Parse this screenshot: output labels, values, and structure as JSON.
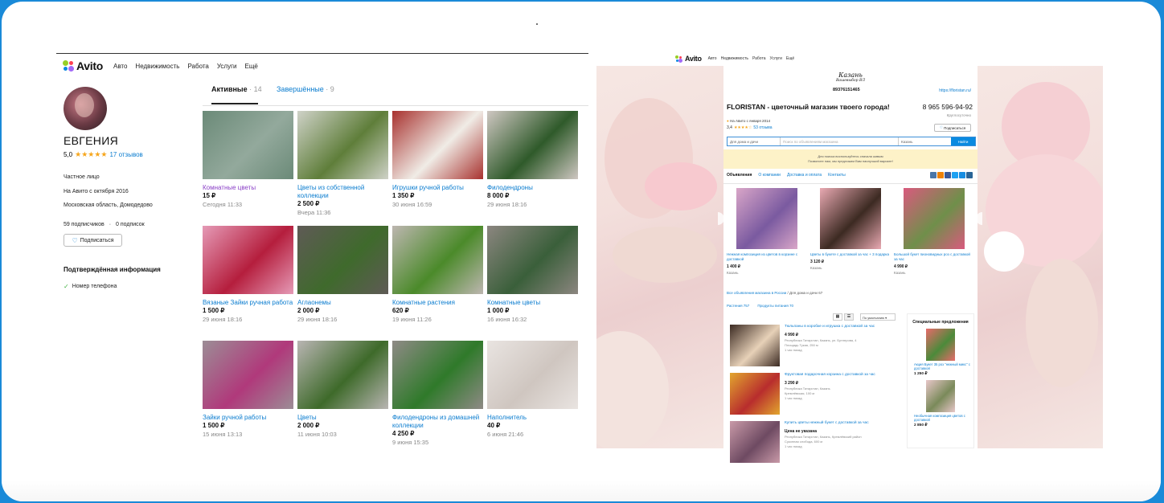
{
  "avito": {
    "logo_text": "Avito",
    "nav": [
      "Авто",
      "Недвижимость",
      "Работа",
      "Услуги",
      "Ещё"
    ],
    "brand_colors": {
      "green": "#97cf26",
      "blue": "#0a8ae0",
      "red": "#ff4053",
      "purple": "#a169f7"
    }
  },
  "profile": {
    "name": "ЕВГЕНИЯ",
    "rating_value": "5,0",
    "stars": "★★★★★",
    "reviews_link": "17 отзывов",
    "seller_type": "Частное лицо",
    "since": "На Авито с октября 2016",
    "location": "Московская область, Домодедово",
    "subscribers": "59 подписчиков",
    "subscriptions": "0 подписок",
    "subscribe_button": "Подписаться",
    "verified_title": "Подтверждённая информация",
    "verified_items": [
      "Номер телефона"
    ]
  },
  "tabs": {
    "active_label": "Активные",
    "active_count": "14",
    "done_label": "Завершённые",
    "done_count": "9"
  },
  "listings": [
    {
      "title": "Комнатные цветы",
      "price": "15 ₽",
      "date": "Сегодня 11:33",
      "visited": true,
      "colors": [
        "#6b8a78",
        "#93a99c"
      ]
    },
    {
      "title": "Цветы из собственной коллекции",
      "price": "2 500 ₽",
      "date": "Вчера 11:36",
      "visited": false,
      "colors": [
        "#cfd2c8",
        "#5f7e3a"
      ]
    },
    {
      "title": "Игрушки ручной работы",
      "price": "1 350 ₽",
      "date": "30 июня 16:59",
      "visited": false,
      "colors": [
        "#a8322f",
        "#f0ece6"
      ]
    },
    {
      "title": "Филодендроны",
      "price": "8 000 ₽",
      "date": "29 июня 18:16",
      "visited": false,
      "colors": [
        "#cfc7c2",
        "#2f5a2a"
      ]
    },
    {
      "title": "Вязаные Зайки ручная работа",
      "price": "1 500 ₽",
      "date": "29 июня 18:16",
      "visited": false,
      "colors": [
        "#e59ab6",
        "#b51e3d"
      ]
    },
    {
      "title": "Аглаонемы",
      "price": "2 000 ₽",
      "date": "29 июня 18:16",
      "visited": false,
      "colors": [
        "#5f5a56",
        "#3f6a2c"
      ]
    },
    {
      "title": "Комнатные растения",
      "price": "620 ₽",
      "date": "19 июня 11:26",
      "visited": false,
      "colors": [
        "#bdb6b0",
        "#4b8a2a"
      ]
    },
    {
      "title": "Комнатные цветы",
      "price": "1 000 ₽",
      "date": "16 июня 16:32",
      "visited": false,
      "colors": [
        "#8c8680",
        "#3a5f3a"
      ]
    },
    {
      "title": "Зайки ручной работы",
      "price": "1 500 ₽",
      "date": "15 июня 13:13",
      "visited": false,
      "colors": [
        "#9c8d96",
        "#b0397b"
      ]
    },
    {
      "title": "Цветы",
      "price": "2 000 ₽",
      "date": "11 июня 10:03",
      "visited": false,
      "colors": [
        "#b9b5b3",
        "#3e6a2a"
      ]
    },
    {
      "title": "Филодендроны из домашней коллекции",
      "price": "4 250 ₽",
      "date": "9 июня 15:35",
      "visited": false,
      "colors": [
        "#8f8a86",
        "#2f7a2a"
      ]
    },
    {
      "title": "Наполнитель",
      "price": "40 ₽",
      "date": "6 июня 21:46",
      "visited": false,
      "colors": [
        "#e9e4e1",
        "#cfc6c0"
      ]
    }
  ],
  "store": {
    "logo_line1": "Казань",
    "logo_line2": "Вашевыбор ВЛ",
    "phone_top": "89376151465",
    "url": "https://floristan.ru/",
    "title": "FLORISTAN - цветочный магазин твоего города!",
    "phone": "8 965 596-94-92",
    "hours": "Круглосуточно",
    "since": "На Авито с января 2014",
    "rating_value": "3,4",
    "stars": "★★★★☆",
    "reviews": "53 отзыва",
    "subscribe_button": "Подписаться",
    "search_category": "Для дома и дачи",
    "search_placeholder": "Поиск по объявлениям магазина",
    "search_city": "Казань",
    "search_button": "Найти",
    "banner_line1": "Для поиска воспользуйтесь сначала живым",
    "banner_line2": "Позвоните нам, мы предложим Вам наилучший вариант!",
    "tabs": [
      "Объявления",
      "О компании",
      "Доставка и оплата",
      "Контакты"
    ],
    "carousel": [
      {
        "title": "Нежная композиция из цветов в корзине с доставкой",
        "price": "1 400 ₽",
        "city": "Казань",
        "colors": [
          "#d9a6c8",
          "#7a5aa0"
        ]
      },
      {
        "title": "Цветы в букете с доставкой за час + 3 подарка",
        "price": "3 120 ₽",
        "city": "Казань",
        "colors": [
          "#e9a9b2",
          "#3c2a22"
        ]
      },
      {
        "title": "Большой букет пионовидных роз с доставкой за час",
        "price": "4 990 ₽",
        "city": "Казань",
        "colors": [
          "#d95a7e",
          "#6f8f4a"
        ]
      }
    ],
    "breadcrumb_root": "Все объявления магазина в России",
    "breadcrumb_current": "Для дома и дачи 67",
    "filter_1": "Растения 757",
    "filter_2": "Продукты питания 70",
    "sort": "По умолчанию",
    "list": [
      {
        "title": "Тюльпаны в коробке и игрушка с доставкой за час",
        "price": "4 990 ₽",
        "addr": "Республика Татарстан, Казань, ул. Бутлерова, 4",
        "addr2": "Площадь Тукая, 250 м",
        "time": "1 час назад",
        "colors": [
          "#3b2a22",
          "#e7d1b8"
        ]
      },
      {
        "title": "Фруктовая подарочная корзина с доставкой за час",
        "price": "3 290 ₽",
        "addr": "Республика Татарстан, Казань",
        "addr2": "Кремлёвская, 100 м",
        "time": "1 час назад",
        "colors": [
          "#e2a62e",
          "#b82d2d"
        ]
      },
      {
        "title": "Купить цветы нежный букет с доставкой за час",
        "price": "Цена не указана",
        "addr": "Республика Татарстан, Казань, Кремлёвский район",
        "addr2": "Суконная слобода, 600 м",
        "time": "1 час назад",
        "colors": [
          "#c99aa8",
          "#6e4a62"
        ]
      }
    ],
    "special_title": "Специальные предложения",
    "special": [
      {
        "title": "Акция Букет 35 роз \"нежный микс\" с доставкой",
        "price": "1 250 ₽",
        "colors": [
          "#e86a6a",
          "#4b8a3a"
        ]
      },
      {
        "title": "Необычная композиция цветов с доставкой",
        "price": "2 850 ₽",
        "colors": [
          "#e8c7c9",
          "#7a8a5a"
        ]
      }
    ]
  }
}
